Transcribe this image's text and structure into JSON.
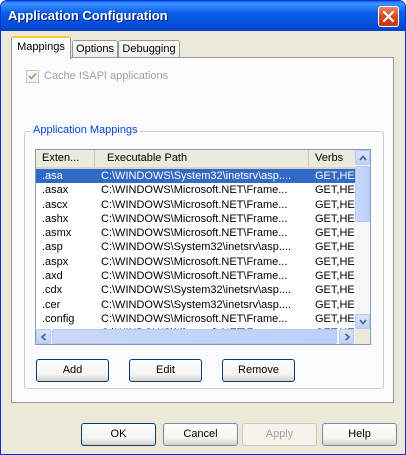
{
  "window": {
    "title": "Application Configuration"
  },
  "tabs": [
    {
      "label": "Mappings",
      "active": true
    },
    {
      "label": "Options",
      "active": false
    },
    {
      "label": "Debugging",
      "active": false
    }
  ],
  "cache_isapi": {
    "label": "Cache ISAPI applications",
    "checked": true,
    "enabled": false
  },
  "mappings_group": {
    "label": "Application Mappings"
  },
  "table": {
    "columns": [
      "Exten...",
      "Executable Path",
      "Verbs"
    ],
    "rows": [
      {
        "ext": ".asa",
        "path": "C:\\WINDOWS\\System32\\inetsrv\\asp....",
        "verbs": "GET,HEA..."
      },
      {
        "ext": ".asax",
        "path": "C:\\WINDOWS\\Microsoft.NET\\Frame...",
        "verbs": "GET,HEA..."
      },
      {
        "ext": ".ascx",
        "path": "C:\\WINDOWS\\Microsoft.NET\\Frame...",
        "verbs": "GET,HEA..."
      },
      {
        "ext": ".ashx",
        "path": "C:\\WINDOWS\\Microsoft.NET\\Frame...",
        "verbs": "GET,HEA..."
      },
      {
        "ext": ".asmx",
        "path": "C:\\WINDOWS\\Microsoft.NET\\Frame...",
        "verbs": "GET,HEA..."
      },
      {
        "ext": ".asp",
        "path": "C:\\WINDOWS\\System32\\inetsrv\\asp....",
        "verbs": "GET,HEA..."
      },
      {
        "ext": ".aspx",
        "path": "C:\\WINDOWS\\Microsoft.NET\\Frame...",
        "verbs": "GET,HEA..."
      },
      {
        "ext": ".axd",
        "path": "C:\\WINDOWS\\Microsoft.NET\\Frame...",
        "verbs": "GET,HEA..."
      },
      {
        "ext": ".cdx",
        "path": "C:\\WINDOWS\\System32\\inetsrv\\asp....",
        "verbs": "GET,HEA..."
      },
      {
        "ext": ".cer",
        "path": "C:\\WINDOWS\\System32\\inetsrv\\asp....",
        "verbs": "GET,HEA..."
      },
      {
        "ext": ".config",
        "path": "C:\\WINDOWS\\Microsoft.NET\\Frame...",
        "verbs": "GET,HEA..."
      },
      {
        "ext": ".cs",
        "path": "C:\\WINDOWS\\Microsoft.NET\\Frame...",
        "verbs": "GET,HEA..."
      }
    ],
    "selected_index": 0
  },
  "list_buttons": {
    "add": "Add",
    "edit": "Edit",
    "remove": "Remove"
  },
  "dialog_buttons": {
    "ok": "OK",
    "cancel": "Cancel",
    "apply": "Apply",
    "help": "Help"
  },
  "colors": {
    "titlebar": "#0a5eea",
    "selection": "#316ac5",
    "group_label": "#0046d5",
    "face": "#ece9d8"
  },
  "icons": [
    "close-icon",
    "checkmark-icon",
    "arrow-up-icon",
    "arrow-down-icon",
    "arrow-left-icon",
    "arrow-right-icon"
  ]
}
